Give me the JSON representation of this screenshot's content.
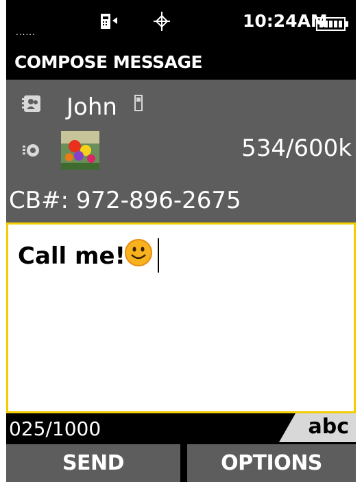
{
  "status": {
    "signal": "......",
    "time": "10:24AM"
  },
  "screen_title": "COMPOSE MESSAGE",
  "recipient": {
    "name": "John"
  },
  "attachment": {
    "size": "534/600k"
  },
  "callback": "CB#: 972-896-2675",
  "message": {
    "text": "Call me!",
    "emoticon": "smiley-face"
  },
  "counter": "025/1000",
  "input_mode": "abc",
  "softkeys": {
    "left": "SEND",
    "right": "OPTIONS"
  },
  "colors": {
    "accent": "#f4cc00",
    "header_bg": "#5d5d5d"
  }
}
